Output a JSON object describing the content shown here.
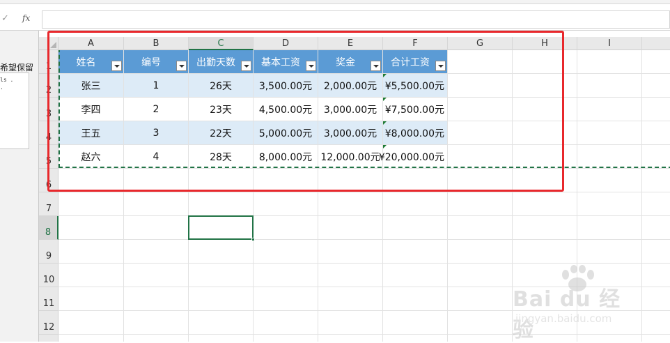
{
  "formula_bar": {
    "fx_label": "fx",
    "check_icon": "✓",
    "value": ""
  },
  "side_pane": {
    "text": "希望保留",
    "code_snippet": "ls .\n."
  },
  "columns": [
    "A",
    "B",
    "C",
    "D",
    "E",
    "F",
    "G",
    "H",
    "I"
  ],
  "rows": [
    "1",
    "2",
    "3",
    "4",
    "5",
    "6",
    "7",
    "8",
    "9",
    "10",
    "11",
    "12"
  ],
  "table": {
    "headers": [
      "姓名",
      "编号",
      "出勤天数",
      "基本工资",
      "奖金",
      "合计工资"
    ],
    "rows": [
      [
        "张三",
        "1",
        "26天",
        "3,500.00元",
        "2,000.00元",
        "¥5,500.00元"
      ],
      [
        "李四",
        "2",
        "23天",
        "4,500.00元",
        "3,000.00元",
        "¥7,500.00元"
      ],
      [
        "王五",
        "3",
        "22天",
        "5,000.00元",
        "3,000.00元",
        "¥8,000.00元"
      ],
      [
        "赵六",
        "4",
        "28天",
        "8,000.00元",
        "12,000.00元",
        "¥20,000.00元"
      ]
    ]
  },
  "colors": {
    "header_fill": "#5b9bd5",
    "band_fill": "#ddebf7",
    "excel_green": "#217346",
    "highlight_red": "#e8282c"
  },
  "watermark": {
    "brand": "Bai du 经验",
    "url": "jingyan.baidu.com"
  }
}
